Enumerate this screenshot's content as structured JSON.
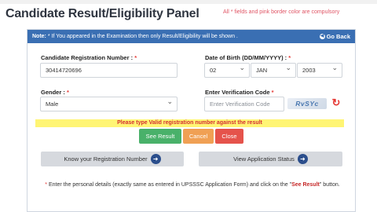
{
  "header": {
    "title": "Candidate Result/Eligibility Panel",
    "required_note": "All * fields and pink border color are compulsory"
  },
  "notice_bar": {
    "label": "Note:",
    "text": " * If You appeared in the Examination then only Result/Eligibility will be shown .",
    "go_back_icon": "left-arrow-circle-icon",
    "go_back_label": "Go Back"
  },
  "form": {
    "registration": {
      "label": "Candidate Registration Number :",
      "required": "*",
      "value": "30414720696"
    },
    "dob": {
      "label": "Date of Birth (DD/MM/YYYY) :",
      "required": "*",
      "day": "02",
      "month": "JAN",
      "year": "2003"
    },
    "gender": {
      "label": "Gender :",
      "required": "*",
      "value": "Male"
    },
    "verification": {
      "label": "Enter Verification Code",
      "required": "*",
      "placeholder": "Enter Verification Code",
      "captcha_text": "RvSYc",
      "refresh_icon": "refresh-icon"
    },
    "warning": "Please type Valid registration number against the result"
  },
  "buttons": {
    "see_result": "See Result",
    "cancel": "Cancel",
    "close": "Close",
    "know_registration": "Know your Registration Number",
    "view_status": "View Application Status"
  },
  "colors": {
    "bar": "#3a6fb3",
    "green": "#49b16a",
    "orange": "#f0a054",
    "red": "#e5534b",
    "warning_bg": "#fff574"
  },
  "footer": {
    "star": "*",
    "text": " Enter the personal details (exactly same as entered in UPSSSC Application Form) and click on the \"",
    "bold": "See Result",
    "end": "\" button."
  }
}
